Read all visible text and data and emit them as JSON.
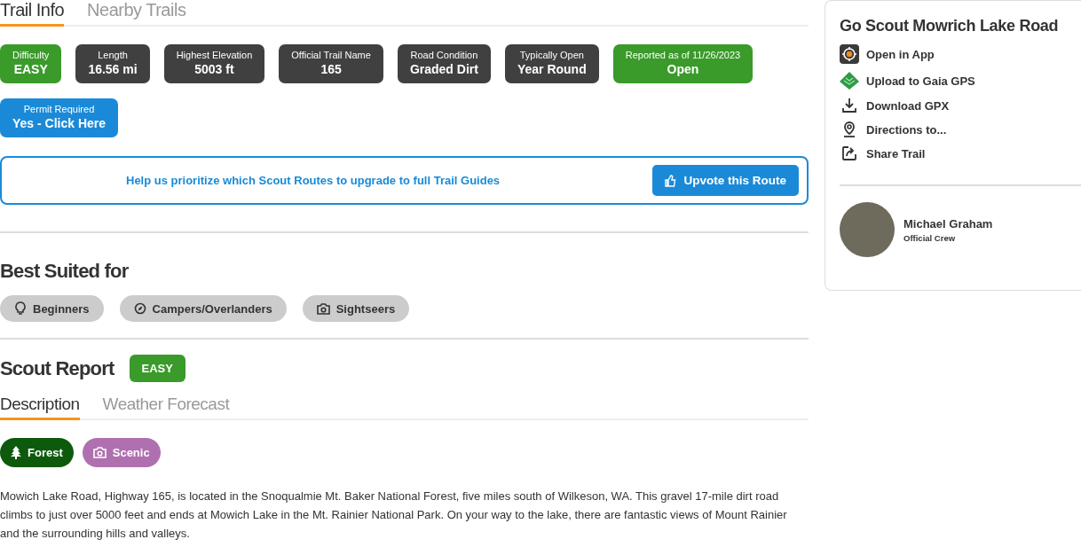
{
  "tabs": [
    {
      "label": "Trail Info",
      "selected": true
    },
    {
      "label": "Nearby Trails",
      "selected": false
    }
  ],
  "stats": [
    {
      "label": "Difficulty",
      "value": "EASY",
      "color": "#3a9a2a"
    },
    {
      "label": "Length",
      "value": "16.56 mi",
      "color": "#404040"
    },
    {
      "label": "Highest Elevation",
      "value": "5003 ft",
      "color": "#404040"
    },
    {
      "label": "Official Trail Name",
      "value": "165",
      "color": "#404040"
    },
    {
      "label": "Road Condition",
      "value": "Graded Dirt",
      "color": "#404040"
    },
    {
      "label": "Typically Open",
      "value": "Year Round",
      "color": "#404040"
    },
    {
      "label": "Reported as of 11/26/2023",
      "value": "Open",
      "color": "#3a9a2a"
    },
    {
      "label": "Permit Required",
      "value": "Yes - Click Here",
      "color": "#1a8ad8"
    }
  ],
  "upvote": {
    "message": "Help us prioritize which Scout Routes to upgrade to full Trail Guides",
    "button": "Upvote this Route"
  },
  "best_suited": {
    "title": "Best Suited for",
    "items": [
      {
        "label": "Beginners",
        "kind": "bulb"
      },
      {
        "label": "Campers/Overlanders",
        "kind": "compass"
      },
      {
        "label": "Sightseers",
        "kind": "camera"
      }
    ]
  },
  "scout_report": {
    "title": "Scout Report",
    "badge": "EASY",
    "tabs": [
      {
        "label": "Description",
        "selected": true
      },
      {
        "label": "Weather Forecast",
        "selected": false
      }
    ],
    "tags": [
      {
        "label": "Forest",
        "kind": "tree",
        "color": "#0d5a0d"
      },
      {
        "label": "Scenic",
        "kind": "camera",
        "color": "#b070b0"
      }
    ],
    "description": "Mowich Lake Road, Highway 165, is located in the Snoqualmie Mt. Baker National Forest, five miles south of Wilkeson, WA. This gravel 17-mile dirt road climbs to just over 5000 feet and ends at Mowich Lake in the Mt. Rainier National Park. On your way to the lake, there are fantastic views of Mount Rainier and the surrounding hills and valleys."
  },
  "sidebar": {
    "title": "Go Scout Mowrich Lake Road",
    "actions": [
      {
        "label": "Open in App",
        "kind": "app"
      },
      {
        "label": "Upload to Gaia GPS",
        "kind": "gaia"
      },
      {
        "label": "Download GPX",
        "kind": "download"
      },
      {
        "label": "Directions to...",
        "kind": "directions"
      },
      {
        "label": "Share Trail",
        "kind": "share"
      }
    ],
    "author": {
      "name": "Michael Graham",
      "role": "Official Crew"
    }
  }
}
